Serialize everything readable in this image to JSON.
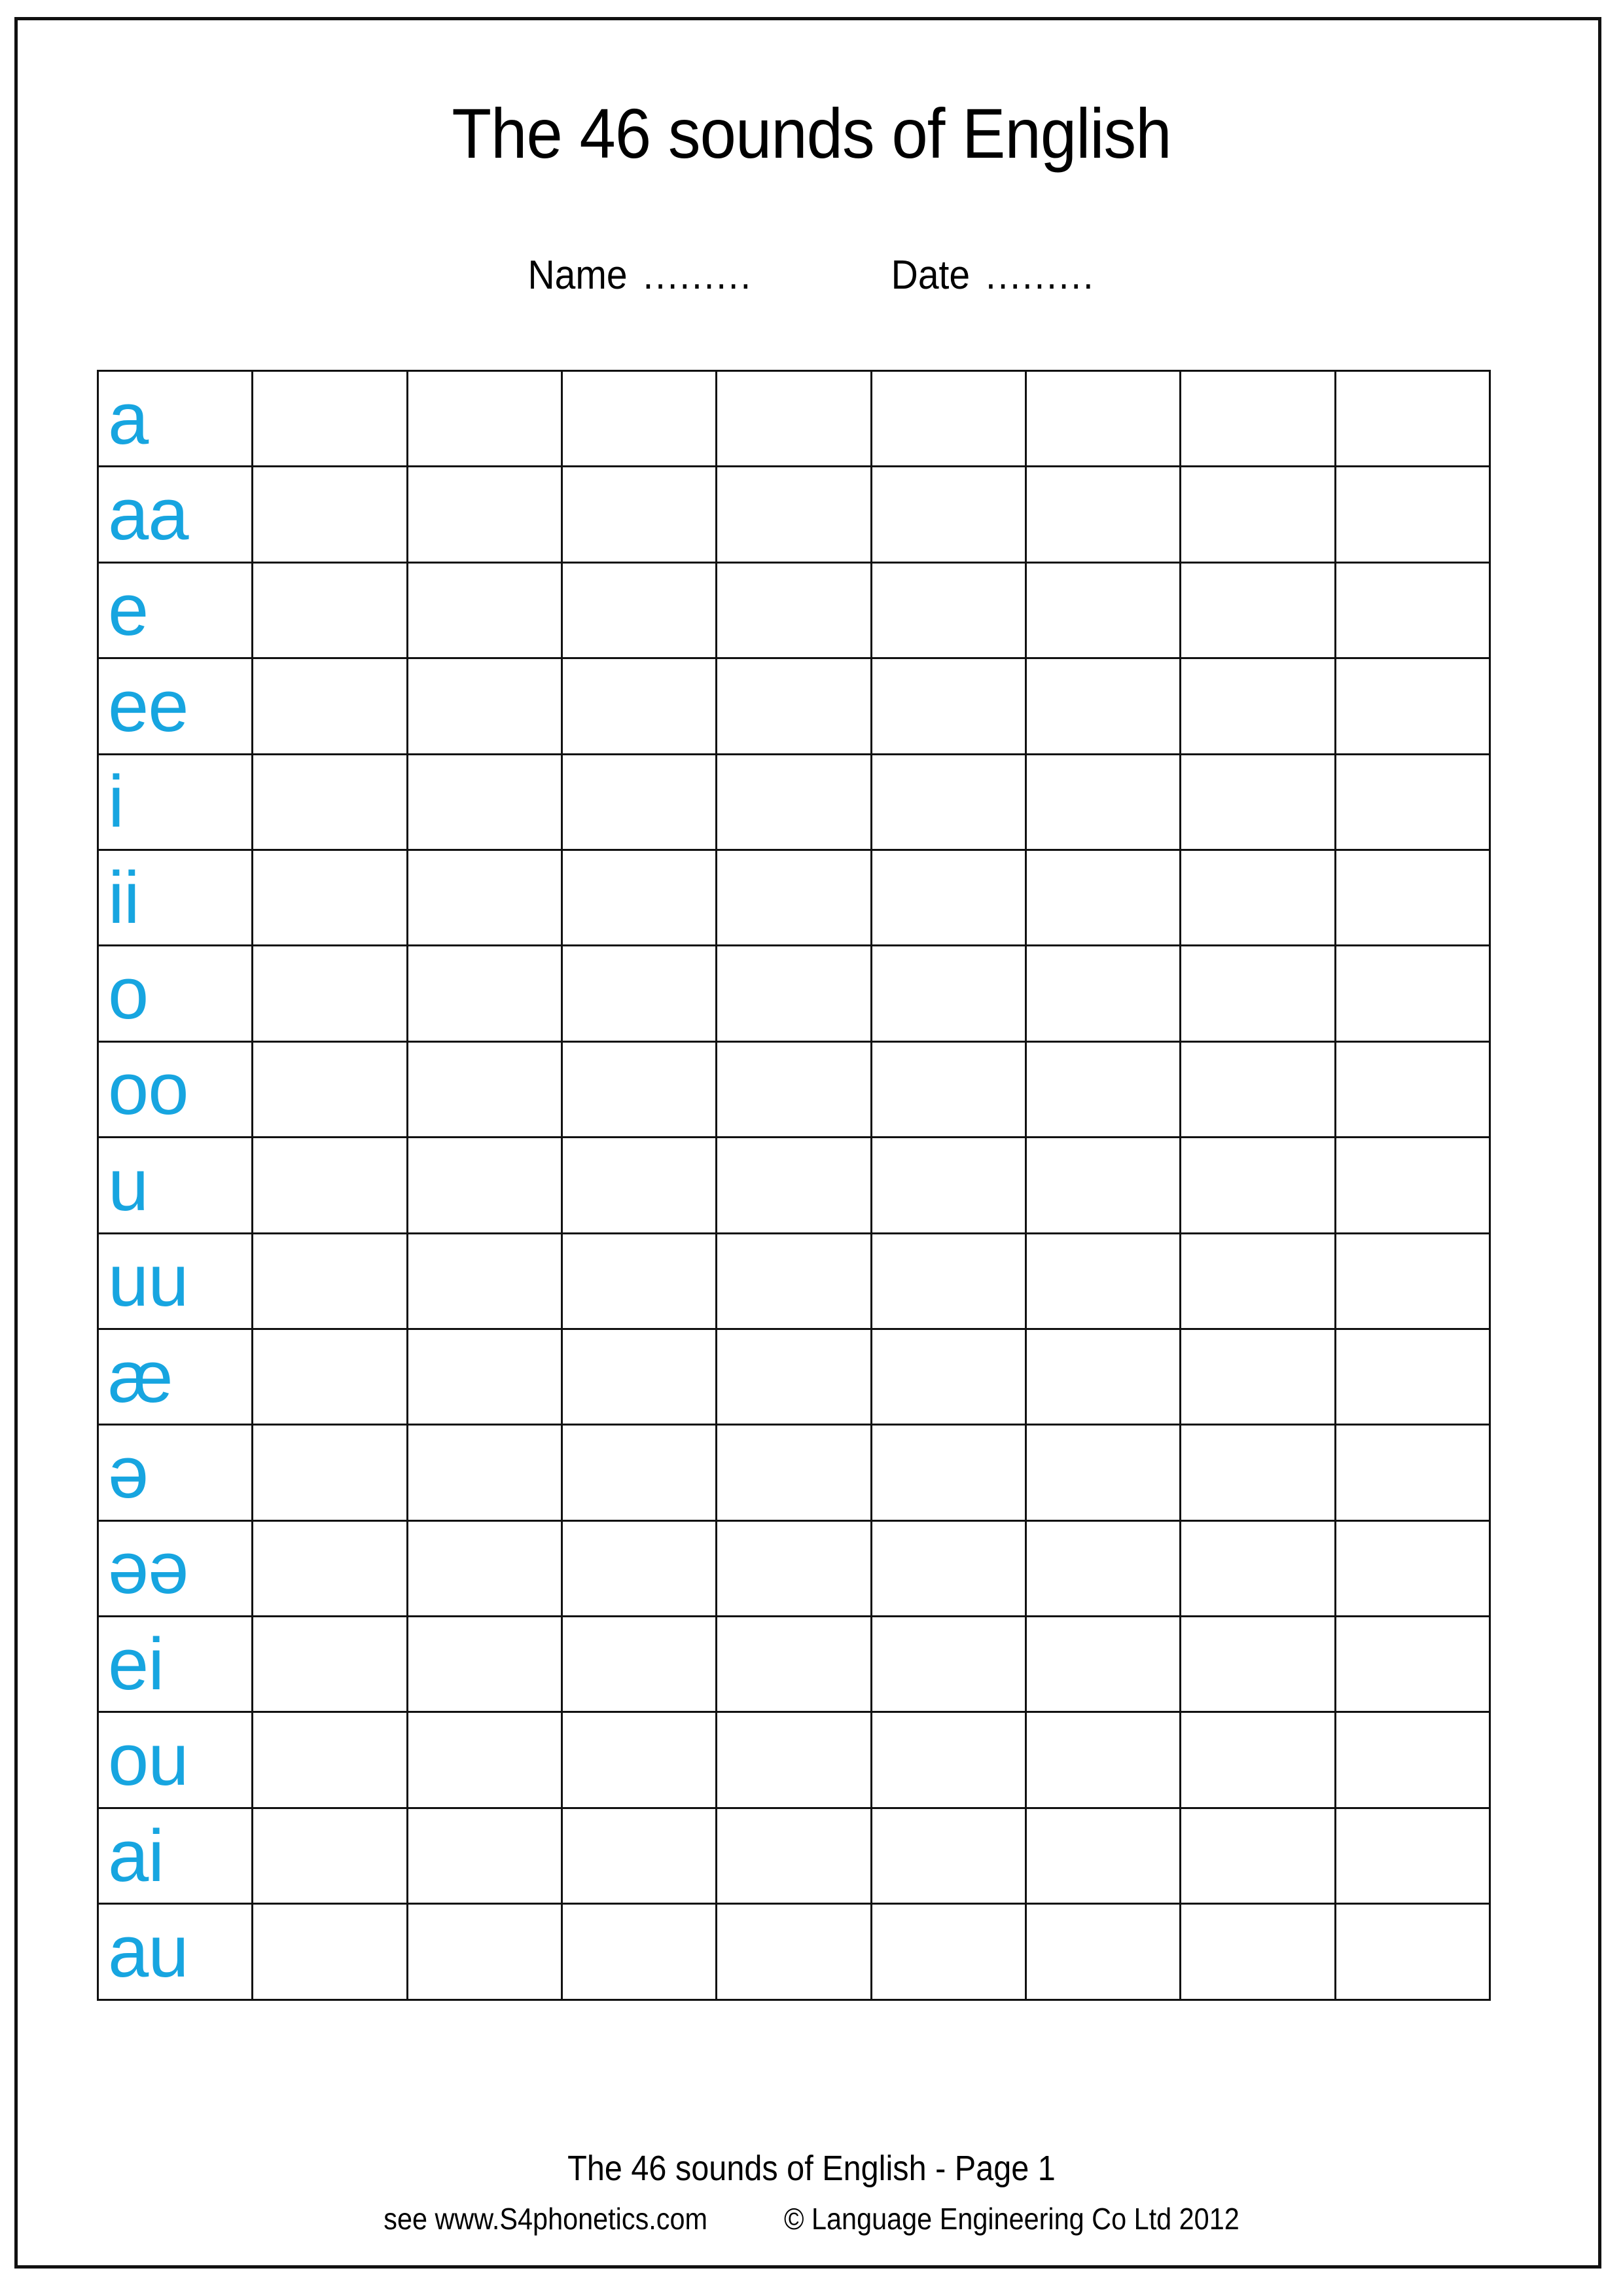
{
  "document": {
    "title": "The 46 sounds of English",
    "page_label": "The 46 sounds of English  -  Page 1",
    "accent_color": "#17A5E0",
    "ink_color": "#111111"
  },
  "header": {
    "title": "The 46 sounds of English",
    "name_label": "Name",
    "name_dots": ".........",
    "date_label": "Date",
    "date_dots": "........."
  },
  "grid": {
    "columns": 9,
    "rows": 17,
    "symbol_column_index": 0,
    "rows_data": [
      {
        "symbol": "a"
      },
      {
        "symbol": "aa"
      },
      {
        "symbol": "e"
      },
      {
        "symbol": "ee"
      },
      {
        "symbol": "i"
      },
      {
        "symbol": "ii"
      },
      {
        "symbol": "o"
      },
      {
        "symbol": "oo"
      },
      {
        "symbol": "u"
      },
      {
        "symbol": "uu"
      },
      {
        "symbol": "æ"
      },
      {
        "symbol": "ə"
      },
      {
        "symbol": "əə"
      },
      {
        "symbol": "ei"
      },
      {
        "symbol": "ou"
      },
      {
        "symbol": "ai"
      },
      {
        "symbol": "au"
      }
    ]
  },
  "footer": {
    "title": "The 46 sounds of English  -  Page 1",
    "site": "see www.S4phonetics.com",
    "copyright": "© Language Engineering Co Ltd 2012"
  }
}
